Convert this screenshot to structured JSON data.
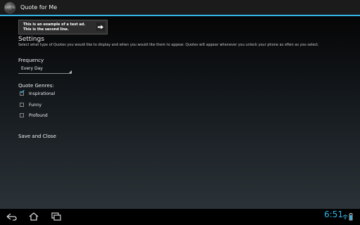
{
  "action_bar": {
    "app_icon_text": "QUOTE",
    "title": "Quote for Me"
  },
  "ad": {
    "text": "This is an example of a test ad. This is the second line.",
    "arrow_icon": "arrow-right-icon"
  },
  "settings": {
    "title": "Settings",
    "description": "Select what type of Quotes you would like to display and when you would like them to appear. Quotes will appear whenever you unlock your phone as often as you select."
  },
  "frequency": {
    "label": "Frequency",
    "selected": "Every Day"
  },
  "genres": {
    "label": "Quote Genres:",
    "items": [
      {
        "label": "Inspirational",
        "checked": true
      },
      {
        "label": "Funny",
        "checked": false
      },
      {
        "label": "Profound",
        "checked": false
      }
    ]
  },
  "save_close_label": "Save and Close",
  "status_bar": {
    "time": "6:51",
    "icons": [
      "wifi-icon",
      "battery-icon"
    ]
  },
  "nav_icons": [
    "back-icon",
    "home-icon",
    "recent-apps-icon"
  ],
  "colors": {
    "accent": "#33b5e5",
    "action_bar_bg": "#1b1b1b"
  }
}
